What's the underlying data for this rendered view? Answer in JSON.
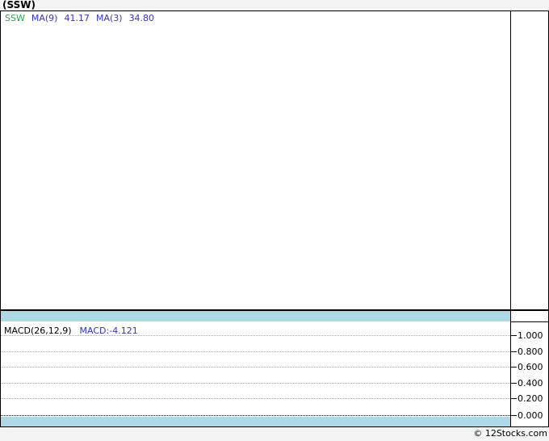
{
  "page": {
    "title": "(SSW)",
    "copyright": "© 12Stocks.com",
    "background": "#f4f4f4"
  },
  "colors": {
    "ticker_green": "#2e9e50",
    "legend_blue": "#3333cc",
    "band_blue": "#add8e6",
    "border_black": "#000000",
    "gridline_gray": "#aaaaaa",
    "panel_white": "#ffffff"
  },
  "main_panel": {
    "legend": {
      "ticker": "SSW",
      "ma9_label": "MA(9)",
      "ma9_value": "41.17",
      "ma3_label": "MA(3)",
      "ma3_value": "34.80"
    }
  },
  "macd_panel": {
    "legend_label": "MACD(26,12,9)",
    "legend_value": "MACD:-4.121",
    "axis_ticks": [
      "1.000",
      "0.800",
      "0.600",
      "0.400",
      "0.200",
      "0.000"
    ]
  },
  "chart_data": [
    {
      "type": "line",
      "title": "SSW price panel with moving averages",
      "series": [
        {
          "name": "SSW",
          "values": []
        },
        {
          "name": "MA(9)",
          "last_value": 41.17,
          "values": []
        },
        {
          "name": "MA(3)",
          "last_value": 34.8,
          "values": []
        }
      ],
      "note": "panel is empty - no price data plotted in screenshot",
      "grid": false,
      "legend_position": "top-left"
    },
    {
      "type": "line",
      "title": "MACD(26,12,9)",
      "last_value": -4.121,
      "ylim": [
        0.0,
        1.0
      ],
      "yticks": [
        1.0,
        0.8,
        0.6,
        0.4,
        0.2,
        0.0
      ],
      "series": [],
      "note": "panel shows only dotted gridlines and zero line - no MACD curve plotted",
      "grid": true,
      "legend_position": "top-left"
    }
  ]
}
